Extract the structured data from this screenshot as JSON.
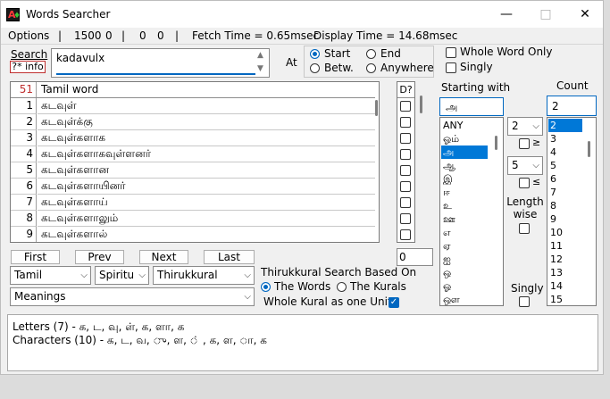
{
  "window": {
    "title": "Words Searcher",
    "min": "—",
    "max": "□",
    "close": "✕"
  },
  "menubar": {
    "options": "Options",
    "sep1": "|",
    "n1": "1500",
    "n2": "0",
    "sep2": "|",
    "n3": "0",
    "n4": "0",
    "sep3": "|",
    "fetch": "Fetch Time = 0.65msec",
    "display": "Display Time = 14.68msec"
  },
  "search": {
    "label": "Search",
    "help": "?* info",
    "value": "kadavulx",
    "at_label": "At"
  },
  "position": {
    "start": "Start",
    "end": "End",
    "between": "Betw.",
    "anywhere": "Anywhere",
    "selected": "start"
  },
  "options": {
    "whole_word": "Whole Word Only",
    "singly": "Singly"
  },
  "grid": {
    "count": "51",
    "column": "Tamil word",
    "d_column": "D?",
    "rows": [
      {
        "n": "1",
        "word": "கடவுள்"
      },
      {
        "n": "2",
        "word": "கடவுள்க்கு"
      },
      {
        "n": "3",
        "word": "கடவுள்களாக"
      },
      {
        "n": "4",
        "word": "கடவுள்களாகவுள்ளனர்"
      },
      {
        "n": "5",
        "word": "கடவுள்களான"
      },
      {
        "n": "6",
        "word": "கடவுள்களாயினர்"
      },
      {
        "n": "7",
        "word": "கடவுள்களாய்"
      },
      {
        "n": "8",
        "word": "கடவுள்களாலும்"
      },
      {
        "n": "9",
        "word": "கடவுள்களால்"
      }
    ]
  },
  "starting": {
    "label": "Starting with",
    "value": "அ",
    "items": [
      "ANY",
      "ஓம்",
      "அ",
      "ஆ",
      "இ",
      "ஈ",
      "உ",
      "ஊ",
      "எ",
      "ஏ",
      "ஐ",
      "ஒ",
      "ஓ",
      "ஔ"
    ],
    "selected_index": 2
  },
  "length": {
    "min": "2",
    "max": "5",
    "ge": "≥",
    "le": "≤",
    "label": "Length wise",
    "singly": "Singly"
  },
  "count": {
    "label": "Count",
    "value": "2",
    "items": [
      "2",
      "3",
      "4",
      "5",
      "6",
      "7",
      "8",
      "9",
      "10",
      "11",
      "12",
      "13",
      "14",
      "15"
    ],
    "selected_index": 0
  },
  "nav": {
    "first": "First",
    "prev": "Prev",
    "next": "Next",
    "last": "Last",
    "page": "0"
  },
  "filters": {
    "lang": "Tamil",
    "category": "Spiritu",
    "book": "Thirukkural",
    "meanings": "Meanings"
  },
  "kural": {
    "label": "Thirukkural Search Based On",
    "words": "The Words",
    "kurals": "The Kurals",
    "whole": "Whole Kural as one Unit"
  },
  "output": {
    "letters": "Letters (7) -  க, ட, வு, ள், க, ளா, க",
    "characters": "Characters (10) - க,  ட,  வ,  ு,  ள,  ் ,  க,  ள,  ா,  க"
  }
}
